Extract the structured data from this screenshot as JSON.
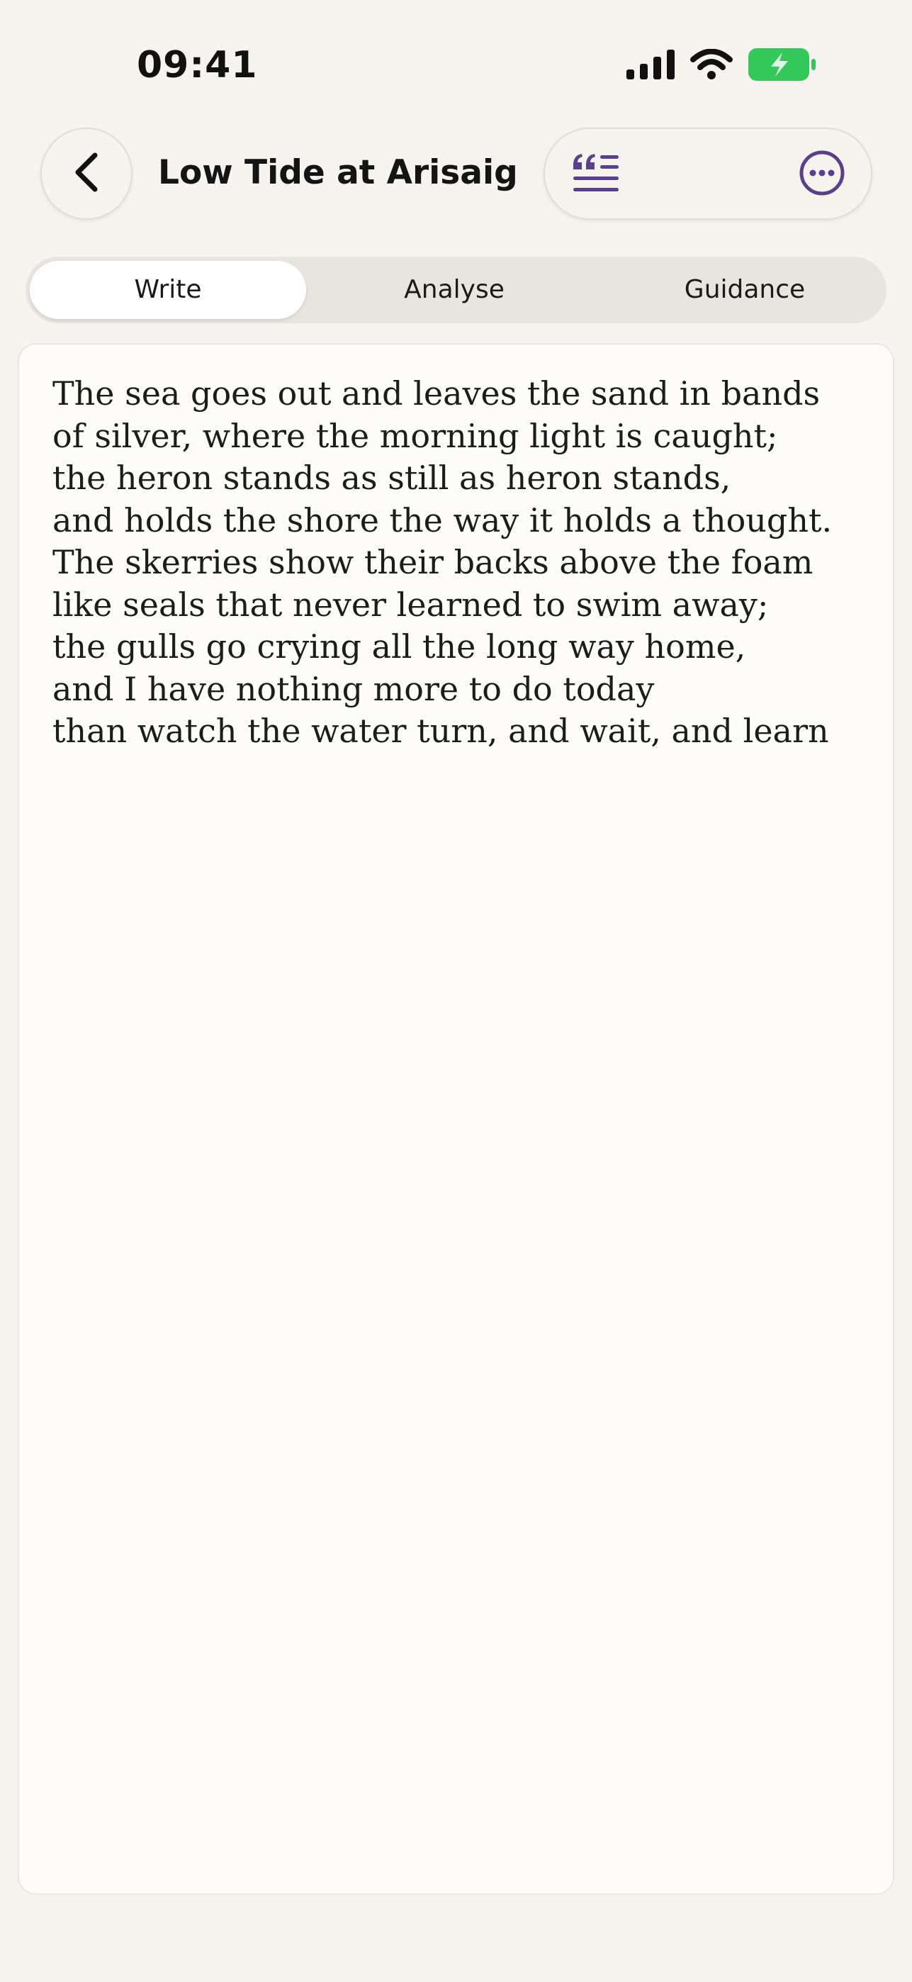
{
  "status_bar": {
    "time": "09:41",
    "icons": [
      "cellular-signal-icon",
      "wifi-icon",
      "battery-charging-icon"
    ],
    "battery_color": "#34c759"
  },
  "header": {
    "title": "Low Tide at Arisaig",
    "back_icon": "chevron-left-icon",
    "actions": [
      "quote-list-icon",
      "more-icon"
    ]
  },
  "tabs": [
    {
      "label": "Write",
      "selected": true
    },
    {
      "label": "Analyse",
      "selected": false
    },
    {
      "label": "Guidance",
      "selected": false
    }
  ],
  "editor": {
    "lines": [
      "The sea goes out and leaves the sand in bands",
      "of silver, where the morning light is caught;",
      "the heron stands as still as heron stands,",
      "and holds the shore the way it holds a thought.",
      "The skerries show their backs above the foam",
      "like seals that never learned to swim away;",
      "the gulls go crying all the long way home,",
      "and I have nothing more to do today",
      "than watch the water turn, and wait, and learn"
    ]
  },
  "colors": {
    "accent": "#5b3f8c",
    "background": "#f7f4ef",
    "editor_background": "#fdfcf8"
  }
}
